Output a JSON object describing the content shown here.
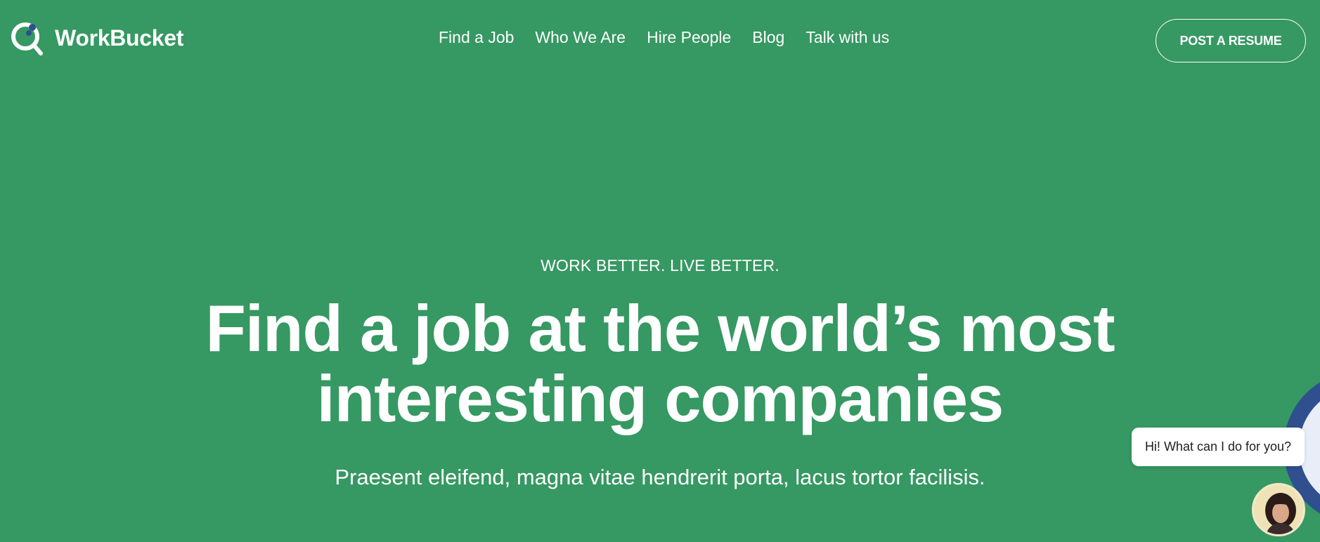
{
  "header": {
    "brand": "WorkBucket",
    "nav": [
      "Find a Job",
      "Who We Are",
      "Hire People",
      "Blog",
      "Talk with us"
    ],
    "cta": "POST A RESUME"
  },
  "hero": {
    "eyebrow": "WORK BETTER. LIVE BETTER.",
    "headline_line1": "Find a job at the world’s most",
    "headline_line2": "interesting companies",
    "subline": "Praesent eleifend, magna vitae hendrerit porta, lacus tortor facilisis."
  },
  "chat": {
    "message": "Hi! What can I do for you?",
    "avatar_icon": "person-avatar-icon"
  },
  "colors": {
    "background": "#369862",
    "text": "#ffffff",
    "logo_accent": "#2e4f8f",
    "chat_ring": "#2f4f8f"
  }
}
